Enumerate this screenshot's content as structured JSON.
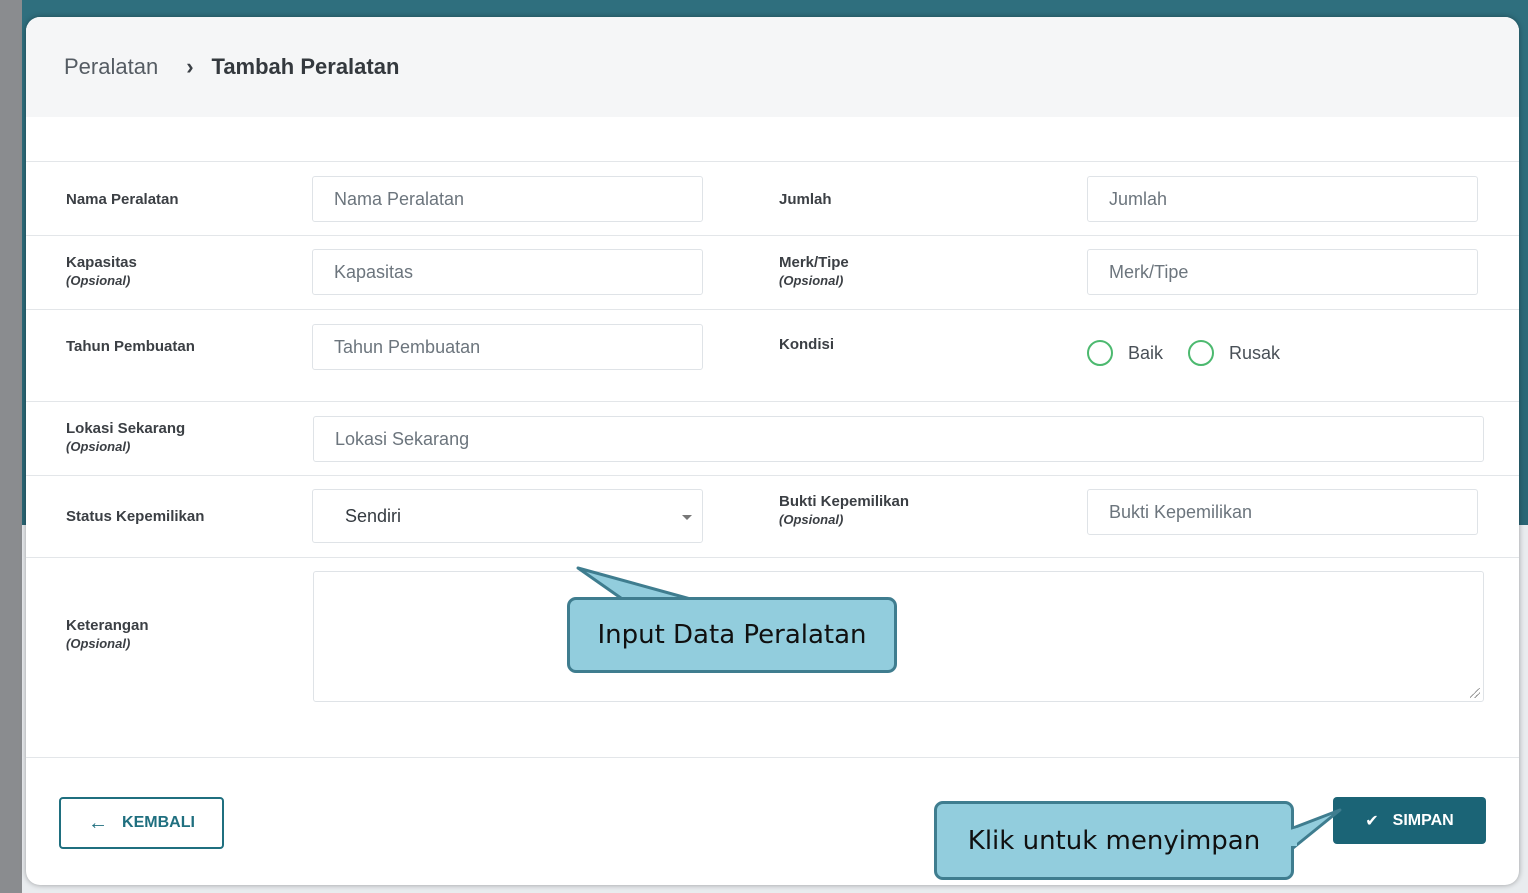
{
  "breadcrumb": {
    "parent": "Peralatan",
    "separator": "›",
    "current": "Tambah Peralatan"
  },
  "form": {
    "nama_peralatan": {
      "label": "Nama Peralatan",
      "placeholder": "Nama Peralatan"
    },
    "jumlah": {
      "label": "Jumlah",
      "placeholder": "Jumlah"
    },
    "kapasitas": {
      "label": "Kapasitas",
      "optional": "(Opsional)",
      "placeholder": "Kapasitas"
    },
    "merk_tipe": {
      "label": "Merk/Tipe",
      "optional": "(Opsional)",
      "placeholder": "Merk/Tipe"
    },
    "tahun_pembuatan": {
      "label": "Tahun Pembuatan",
      "placeholder": "Tahun Pembuatan"
    },
    "kondisi": {
      "label": "Kondisi",
      "options": [
        "Baik",
        "Rusak"
      ]
    },
    "lokasi_sekarang": {
      "label": "Lokasi Sekarang",
      "optional": "(Opsional)",
      "placeholder": "Lokasi Sekarang"
    },
    "status_kepemilikan": {
      "label": "Status Kepemilikan",
      "value": "Sendiri"
    },
    "bukti_kepemilikan": {
      "label": "Bukti Kepemilikan",
      "optional": "(Opsional)",
      "placeholder": "Bukti Kepemilikan"
    },
    "keterangan": {
      "label": "Keterangan",
      "optional": "(Opsional)"
    }
  },
  "buttons": {
    "back_label": "KEMBALI",
    "save_label": "SIMPAN"
  },
  "callouts": {
    "input_data": "Input Data Peralatan",
    "save_hint": "Klik untuk menyimpan"
  },
  "icons": {
    "back": "arrow-left-icon",
    "save": "check-icon",
    "select": "caret-down-icon"
  },
  "colors": {
    "primary": "#1b6476",
    "radio": "#4cb96f",
    "callout_fill": "#92cddd",
    "callout_border": "#3f7d8f"
  }
}
